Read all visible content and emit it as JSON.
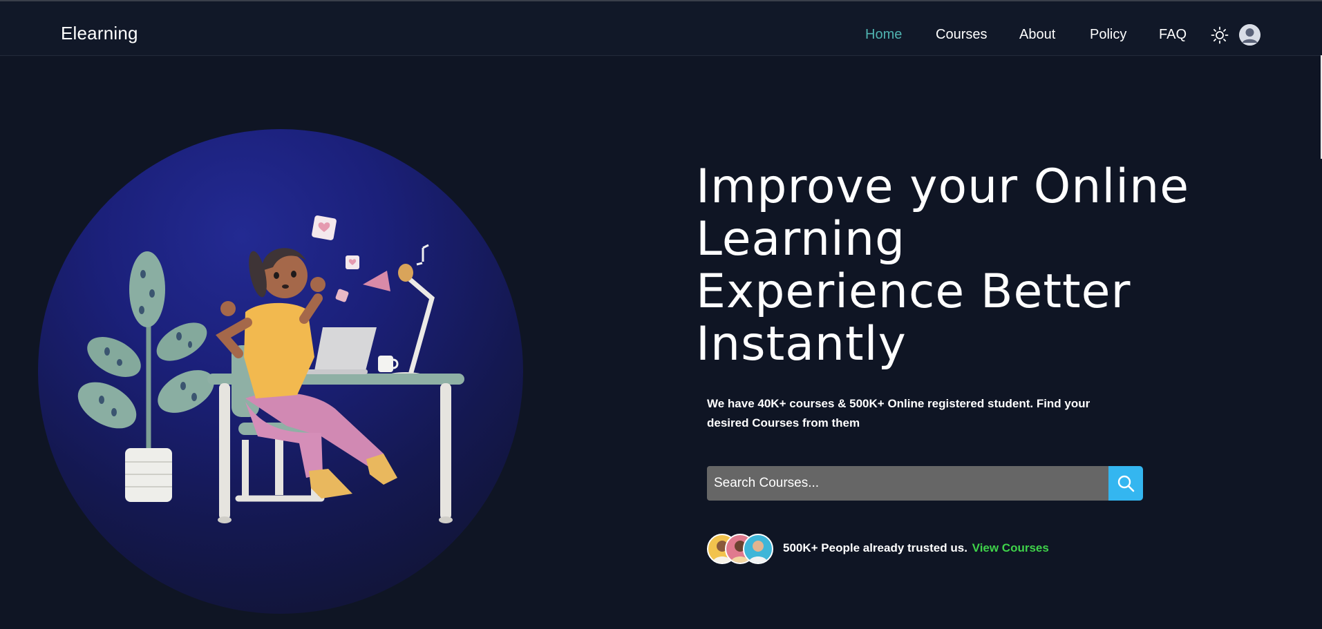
{
  "app": {
    "brand": "Elearning"
  },
  "nav": {
    "links": [
      {
        "label": "Home",
        "active": true
      },
      {
        "label": "Courses",
        "active": false
      },
      {
        "label": "About",
        "active": false
      },
      {
        "label": "Policy",
        "active": false
      },
      {
        "label": "FAQ",
        "active": false
      }
    ],
    "theme_icon": "sun-icon",
    "profile_icon": "user-avatar-icon"
  },
  "hero": {
    "title_lines": [
      "Improve your Online",
      "Learning",
      "Experience Better",
      "Instantly"
    ],
    "description": "We have 40K+ courses & 500K+ Online registered student. Find your desired Courses from them",
    "search": {
      "placeholder": "Search Courses...",
      "value": "",
      "button_icon": "search-icon"
    },
    "trust": {
      "text": "500K+ People already trusted us.",
      "link": "View Courses"
    }
  },
  "colors": {
    "background": "#0f1524",
    "navbar": "#111828",
    "active_link": "#4fb3b0",
    "search_button": "#34b6f0",
    "link_green": "#3fd24a",
    "circle": "#1b207a"
  }
}
